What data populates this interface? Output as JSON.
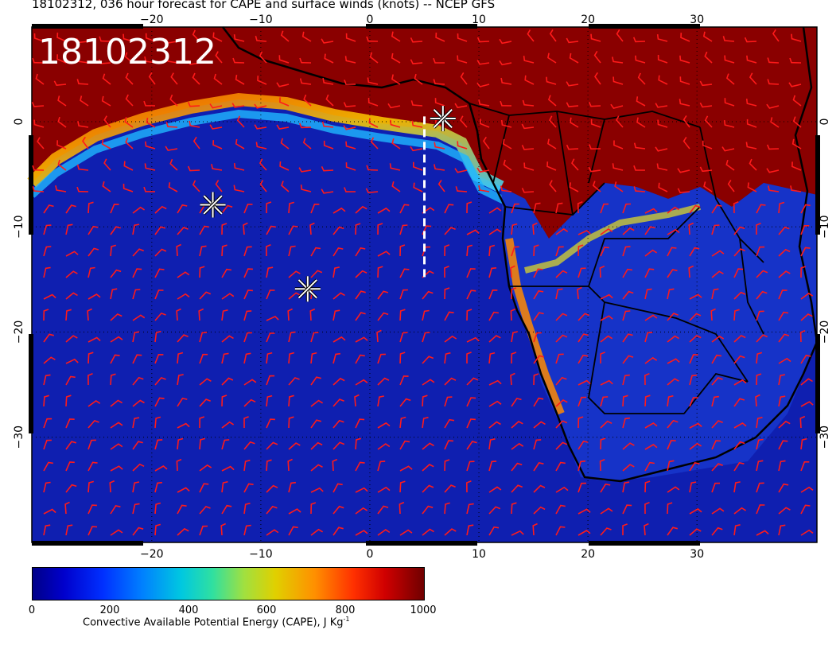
{
  "title": "18102312, 036 hour forecast for CAPE and surface winds (knots) -- NCEP GFS",
  "date_label": "18102312",
  "axes": {
    "x_ticks": [
      "−20",
      "−10",
      "0",
      "10",
      "20",
      "30"
    ],
    "y_ticks": [
      "0",
      "−10",
      "−20",
      "−30"
    ]
  },
  "colorbar": {
    "labels": [
      "0",
      "200",
      "400",
      "600",
      "800",
      "1000"
    ],
    "title": "Convective Available Potential Energy (CAPE), J Kg",
    "unit_superscript": "-1"
  },
  "map": {
    "lon_range": [
      -31,
      41
    ],
    "lat_range": [
      -40,
      9
    ],
    "markers": [
      {
        "lon": -14.4,
        "lat": -7.9
      },
      {
        "lon": -5.7,
        "lat": -15.9
      },
      {
        "lon": 6.7,
        "lat": 0.3
      }
    ],
    "transect": {
      "lon": 5,
      "lat_start": 0.5,
      "lat_end": -15
    },
    "colors": {
      "low": "#00008c",
      "high": "#7a0000",
      "barbs": "#ff1a1a"
    }
  }
}
